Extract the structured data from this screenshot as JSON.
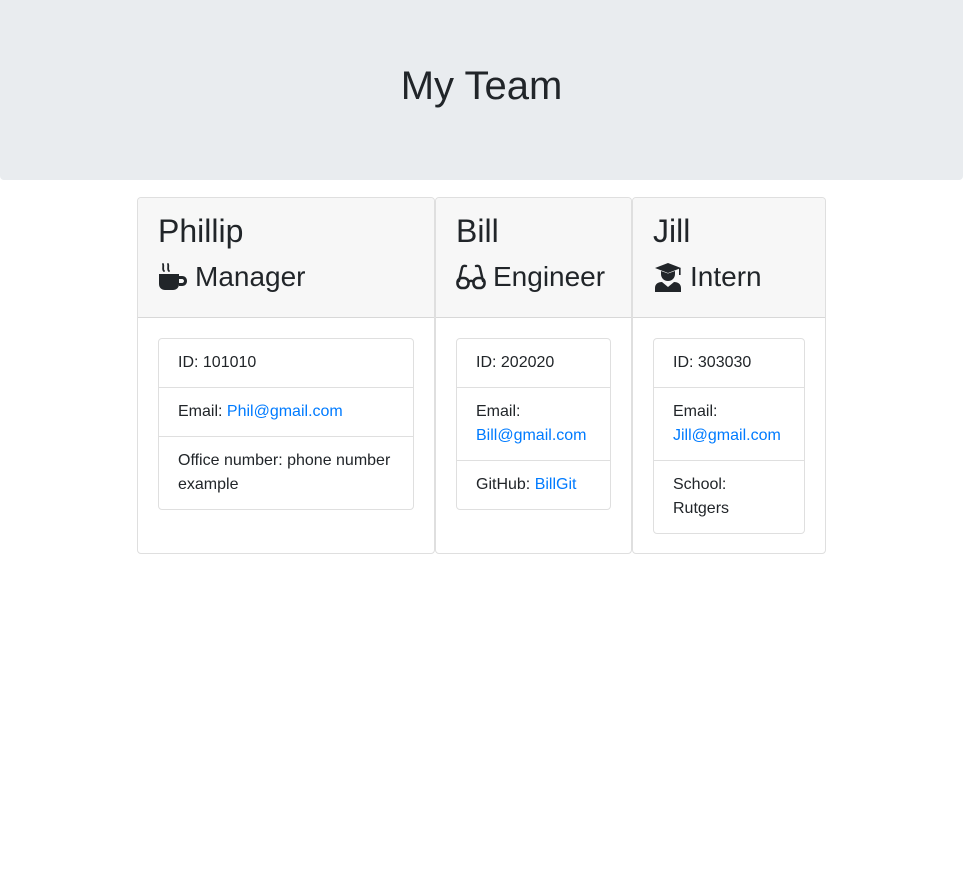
{
  "header": {
    "title": "My Team"
  },
  "employees": [
    {
      "name": "Phillip",
      "role": "Manager",
      "role_icon": "mug-hot-icon",
      "id_label": "ID:",
      "id_value": "101010",
      "email_label": "Email:",
      "email": "Phil@gmail.com",
      "extra_label": "Office number:",
      "extra_value": "phone number example"
    },
    {
      "name": "Bill",
      "role": "Engineer",
      "role_icon": "glasses-icon",
      "id_label": "ID:",
      "id_value": "202020",
      "email_label": "Email:",
      "email": "Bill@gmail.com",
      "extra_label": "GitHub:",
      "extra_value": "BillGit"
    },
    {
      "name": "Jill",
      "role": "Intern",
      "role_icon": "user-graduate-icon",
      "id_label": "ID:",
      "id_value": "303030",
      "email_label": "Email:",
      "email": "Jill@gmail.com",
      "extra_label": "School:",
      "extra_value": "Rutgers"
    }
  ],
  "colors": {
    "jumbotron": "#e9ecef",
    "card_header": "#f7f7f7",
    "link": "#007bff",
    "text": "#212529"
  }
}
